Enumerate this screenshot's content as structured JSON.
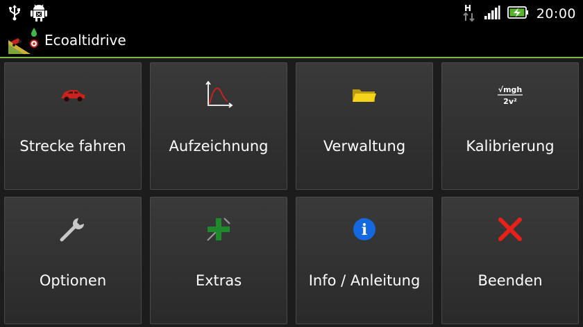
{
  "status_bar": {
    "time": "20:00",
    "network_letter": "H",
    "icons": [
      "usb-icon",
      "android-debug-icon",
      "network-h-icon",
      "signal-icon",
      "battery-charging-icon"
    ]
  },
  "app": {
    "title": "Ecoaltidrive",
    "accent": "#7fb93f"
  },
  "tiles": [
    {
      "label": "Strecke fahren",
      "icon": "car-icon"
    },
    {
      "label": "Aufzeichnung",
      "icon": "chart-icon"
    },
    {
      "label": "Verwaltung",
      "icon": "folder-icon"
    },
    {
      "label": "Kalibrierung",
      "icon": "formula-icon",
      "formula_num": "√mgh",
      "formula_den": "2v²"
    },
    {
      "label": "Optionen",
      "icon": "wrench-icon"
    },
    {
      "label": "Extras",
      "icon": "plus-icon"
    },
    {
      "label": "Info / Anleitung",
      "icon": "info-icon",
      "glyph": "i"
    },
    {
      "label": "Beenden",
      "icon": "close-icon"
    }
  ]
}
